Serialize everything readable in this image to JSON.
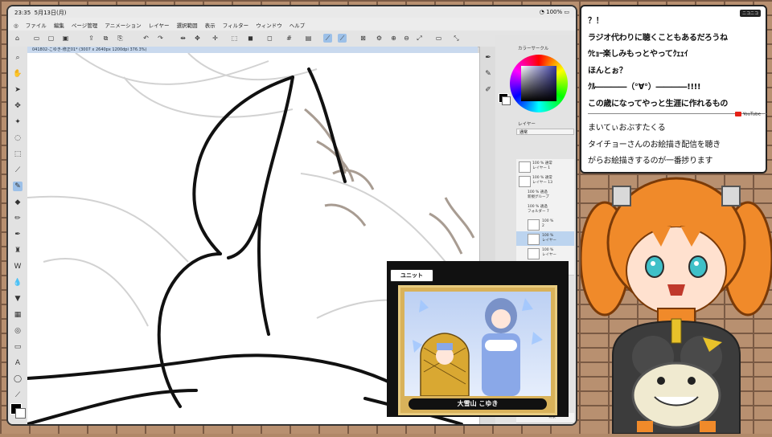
{
  "ipad": {
    "time": "23:35",
    "date": "5月13日(月)",
    "battery": "100%"
  },
  "menu": [
    "ファイル",
    "編集",
    "ページ管理",
    "アニメーション",
    "レイヤー",
    "選択範囲",
    "表示",
    "フィルター",
    "ウィンドウ",
    "ヘルプ"
  ],
  "document_tab": "041802-こゆき-修正01* (3007 x 2640px 1200dpi 376.3%)",
  "panels": {
    "color_circle": "カラーサークル",
    "layer": "レイヤー",
    "blend_mode": "通常"
  },
  "layers": [
    {
      "name": "100 % 通常\nレイヤー 1"
    },
    {
      "name": "100 % 通常\nレイヤー 13"
    },
    {
      "name": "100 % 通過\n新規グループ"
    },
    {
      "name": "100 % 通過\nフォルダー 7"
    },
    {
      "name": "100 %\n2"
    },
    {
      "name": "100 %\nレイヤー",
      "selected": true
    },
    {
      "name": "100 %\nレイヤー"
    },
    {
      "name": "27 % 通過"
    },
    {
      "name": "背景"
    }
  ],
  "card": {
    "header": "ユニット",
    "name": "大雪山 こゆき"
  },
  "chat": {
    "badge": "ニコニコ",
    "youtube_label": "YouTube",
    "messages": [
      "？！",
      "ラジオ代わりに聴くこともあるだろうね",
      "ｳﾋｮｰ楽しみもっとやってｸｪｪｲ",
      "ほんとぉ？",
      "ｸﾙ――――（°∀°）――――!!!!",
      "この歳になってやっと生涯に作れるもの",
      "まいてぃおぶすたくる",
      "タイチョーさんのお絵描き配信を聴き",
      "がらお絵描きするのが一番捗ります"
    ]
  },
  "colors": {
    "selection_blue": "#9cc0e8",
    "youtube_red": "#e62117",
    "avatar_hair": "#f08a2a"
  }
}
